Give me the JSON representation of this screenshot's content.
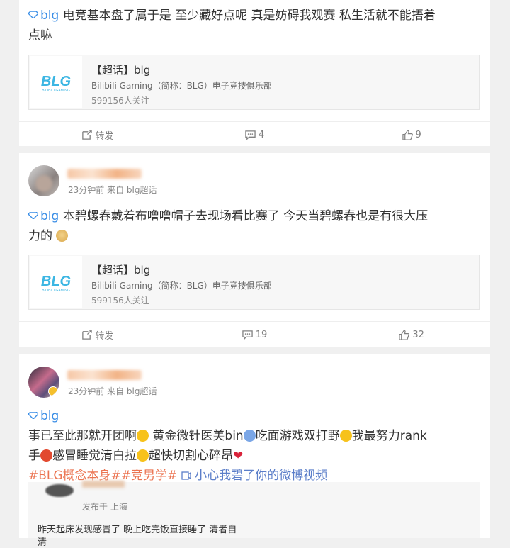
{
  "post1": {
    "tag": "blg",
    "text_line1": " 电竞基本盘了属于是 至少藏好点呢 真是妨碍我观赛 私生活就不能捂着",
    "text_line2": "点嘛",
    "card": {
      "title": "【超话】blg",
      "desc": "Bilibili Gaming（简称：BLG）电子竞技俱乐部",
      "fans": "599156人关注"
    },
    "actions": {
      "repost": "转发",
      "comment": "4",
      "like": "9"
    }
  },
  "post2": {
    "meta": "23分钟前 来自 blg超话",
    "tag": "blg",
    "text_line1": " 本碧螺春戴着布噜噜帽子去现场看比赛了 今天当碧螺春也是有很大压",
    "text_line2": "力的",
    "card": {
      "title": "【超话】blg",
      "desc": "Bilibili Gaming（简称：BLG）电子竞技俱乐部",
      "fans": "599156人关注"
    },
    "actions": {
      "repost": "转发",
      "comment": "19",
      "like": "32"
    }
  },
  "post3": {
    "meta": "23分钟前 来自 blg超话",
    "tag": "blg",
    "line1a": "事已至此那就开团啊",
    "line1b": " 黄金微针医美bin",
    "line1c": "吃面游戏双打野",
    "line1d": "我最努力rank",
    "line2a": "手",
    "line2b": "感冒睡觉清白拉",
    "line2c": "超快切割心碎昂",
    "topics": "#BLG概念本身##竞男学#",
    "video_link": "小心我碧了你的微博视频",
    "repost_meta": "发布于 上海",
    "repost_text": "昨天起床发现感冒了 晚上吃完饭直接睡了 清者自",
    "repost_text2": "清"
  },
  "colors": {
    "accent": "#eb7350",
    "link": "#1a73e8",
    "logo": "#3cb6e3"
  }
}
